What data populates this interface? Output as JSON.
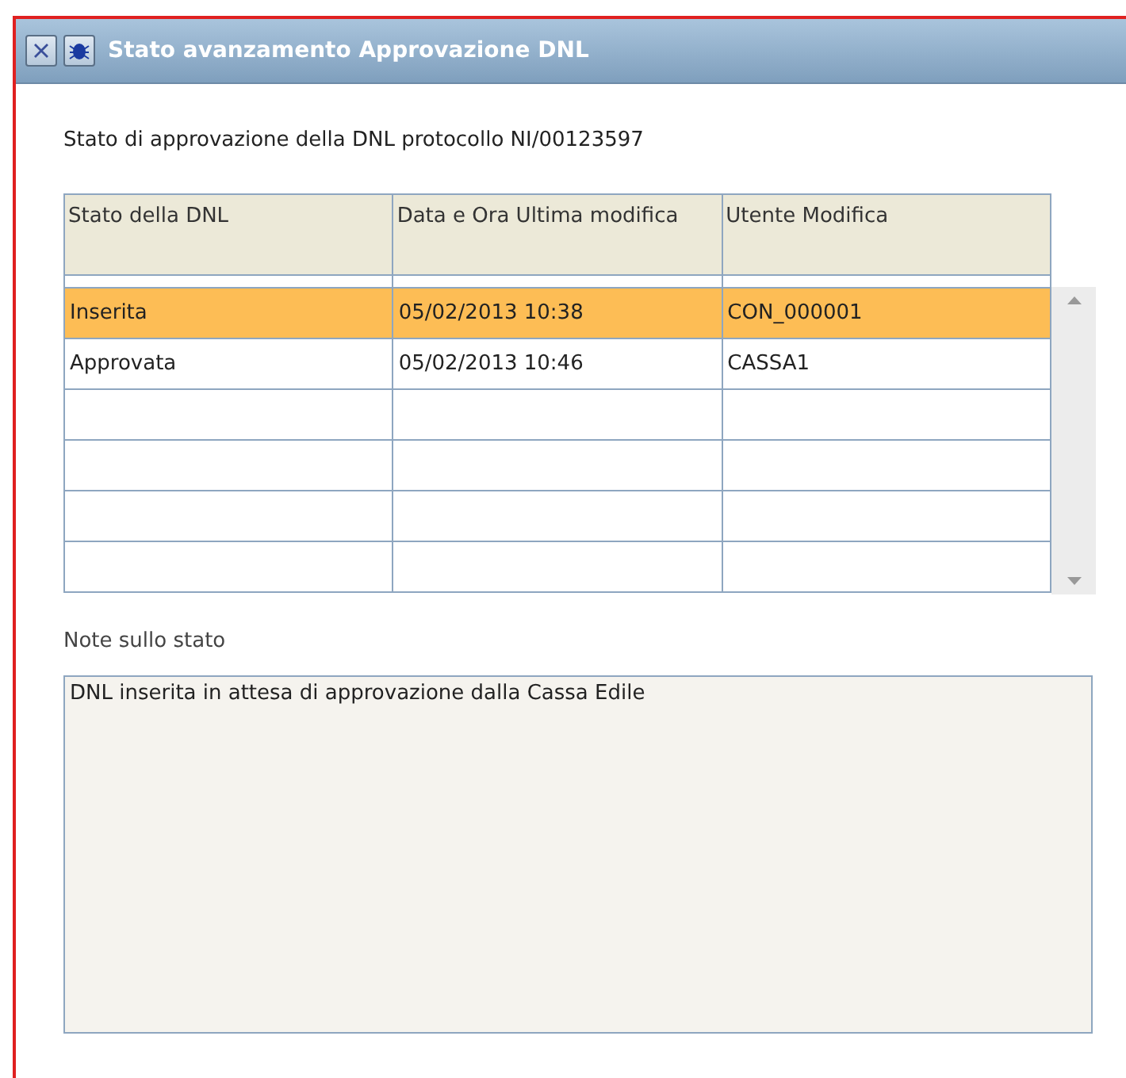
{
  "window": {
    "title": "Stato avanzamento Approvazione DNL"
  },
  "heading": "Stato di approvazione della DNL protocollo NI/00123597",
  "table": {
    "columns": [
      "Stato della DNL",
      "Data e Ora Ultima modifica",
      "Utente Modifica"
    ],
    "rows": [
      {
        "cells": [
          "Inserita",
          "05/02/2013 10:38",
          "CON_000001"
        ],
        "selected": true
      },
      {
        "cells": [
          "Approvata",
          "05/02/2013 10:46",
          "CASSA1"
        ],
        "selected": false
      }
    ]
  },
  "notes": {
    "label": "Note sullo stato",
    "value": "DNL inserita in attesa di approvazione dalla Cassa Edile"
  }
}
